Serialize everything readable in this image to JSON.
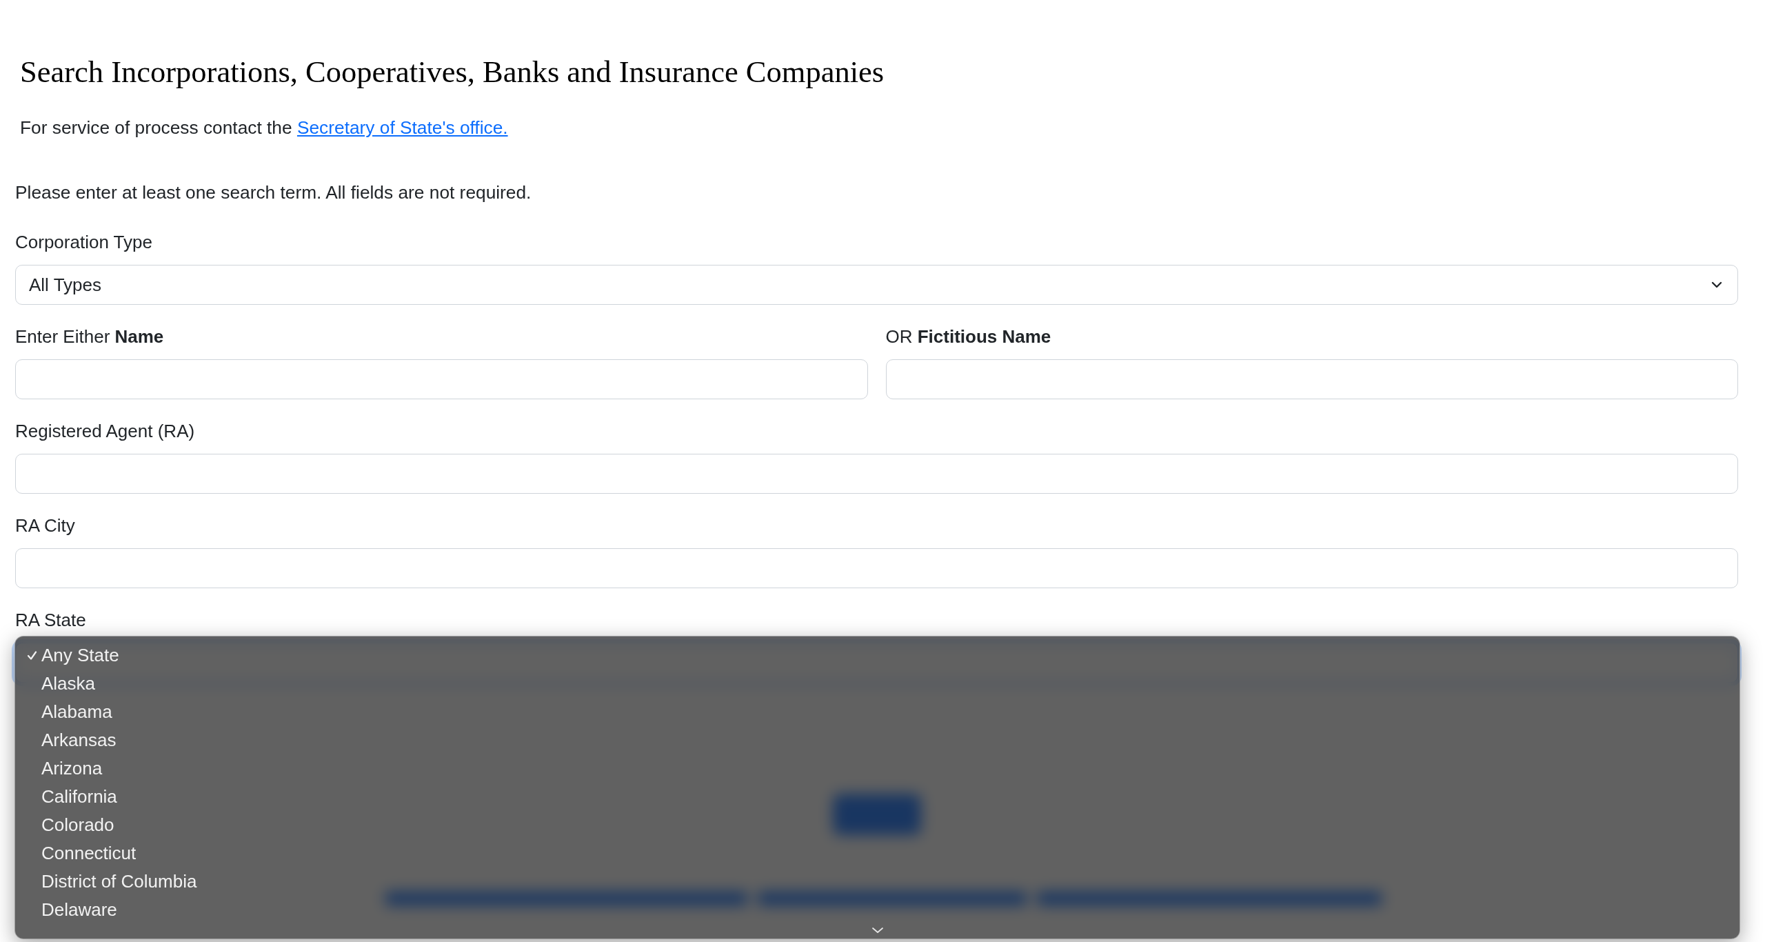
{
  "header": {
    "title": "Search Incorporations, Cooperatives, Banks and Insurance Companies",
    "service_note": {
      "text": "For service of process contact the",
      "link": "Secretary of State's office."
    }
  },
  "form": {
    "instructions": "Please enter at least one search term. All fields are not required.",
    "rows": [
      [
        {
          "kind": "select",
          "label": "Corporation Type",
          "value": "All Types",
          "expanded": false
        }
      ],
      [
        {
          "kind": "text",
          "label": "Enter Either **Name**"
        },
        {
          "kind": "text",
          "label": "OR **Fictitious Name**"
        }
      ],
      [
        {
          "kind": "text",
          "label": "Registered Agent (RA)"
        }
      ],
      [
        {
          "kind": "text",
          "label": "RA City"
        }
      ],
      [
        {
          "kind": "select",
          "label": "RA State",
          "expanded": true,
          "options": [
            {
              "label": "Any State",
              "selected": true
            },
            {
              "label": "Alaska",
              "selected": false
            },
            {
              "label": "Alabama",
              "selected": false
            },
            {
              "label": "Arkansas",
              "selected": false
            },
            {
              "label": "Arizona",
              "selected": false
            },
            {
              "label": "California",
              "selected": false
            },
            {
              "label": "Colorado",
              "selected": false
            },
            {
              "label": "Connecticut",
              "selected": false
            },
            {
              "label": "District of Columbia",
              "selected": false
            },
            {
              "label": "Delaware",
              "selected": false
            }
          ]
        }
      ]
    ]
  }
}
